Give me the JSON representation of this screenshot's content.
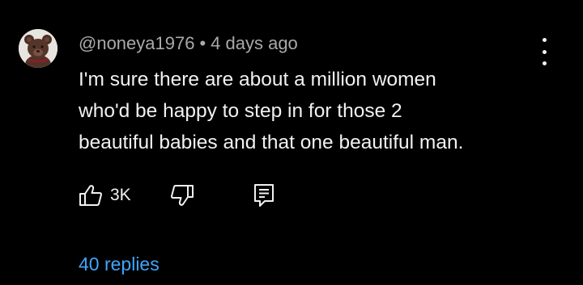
{
  "comment": {
    "author": "@noneya1976",
    "separator": "•",
    "timestamp": "4 days ago",
    "body_lines": [
      "I'm sure there are about a million women",
      "who'd be happy to step in for those 2",
      "beautiful babies and that one beautiful man."
    ],
    "like_count": "3K",
    "replies_label": "40 replies"
  },
  "icons": {
    "avatar": "teddy-bear-avatar",
    "more": "more-vertical-icon",
    "like": "thumbs-up-icon",
    "dislike": "thumbs-down-icon",
    "reply": "reply-comment-icon"
  },
  "colors": {
    "background": "#000000",
    "text_primary": "#f1f1f1",
    "text_secondary": "#aaaaaa",
    "link": "#3ea6ff"
  }
}
